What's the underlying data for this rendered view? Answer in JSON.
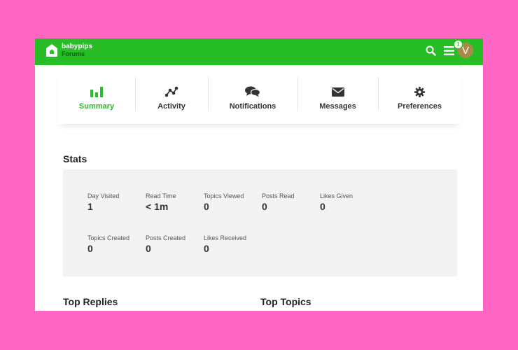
{
  "header": {
    "logo_line1": "babypips",
    "logo_line2": "Forums",
    "notification_count": "1",
    "avatar_letter": "V",
    "accent_color": "#26bd26"
  },
  "nav": {
    "items": [
      {
        "label": "Summary",
        "icon": "bar-chart-icon",
        "active": true
      },
      {
        "label": "Activity",
        "icon": "activity-icon",
        "active": false
      },
      {
        "label": "Notifications",
        "icon": "comments-icon",
        "active": false
      },
      {
        "label": "Messages",
        "icon": "envelope-icon",
        "active": false
      },
      {
        "label": "Preferences",
        "icon": "gear-icon",
        "active": false
      }
    ]
  },
  "stats": {
    "title": "Stats",
    "items": [
      {
        "label": "Day Visited",
        "value": "1"
      },
      {
        "label": "Read Time",
        "value": "< 1m"
      },
      {
        "label": "Topics Viewed",
        "value": "0"
      },
      {
        "label": "Posts Read",
        "value": "0"
      },
      {
        "label": "Likes Given",
        "value": "0"
      },
      {
        "label": "Topics Created",
        "value": "0"
      },
      {
        "label": "Posts Created",
        "value": "0"
      },
      {
        "label": "Likes Received",
        "value": "0"
      }
    ]
  },
  "sections": {
    "top_replies": "Top Replies",
    "top_topics": "Top Topics"
  }
}
